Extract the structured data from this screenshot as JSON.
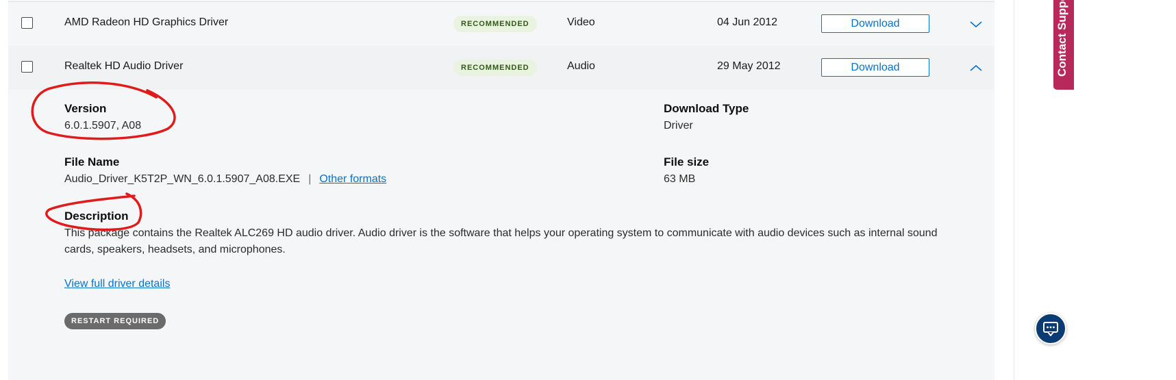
{
  "drivers": [
    {
      "name": "AMD Radeon HD Graphics Driver",
      "badge": "RECOMMENDED",
      "category": "Video",
      "date": "04 Jun 2012",
      "download_label": "Download",
      "expanded": false
    },
    {
      "name": "Realtek HD Audio Driver",
      "badge": "RECOMMENDED",
      "category": "Audio",
      "date": "29 May 2012",
      "download_label": "Download",
      "expanded": true
    }
  ],
  "details": {
    "version_label": "Version",
    "version_value": "6.0.1.5907, A08",
    "download_type_label": "Download Type",
    "download_type_value": "Driver",
    "file_name_label": "File Name",
    "file_name_value": "Audio_Driver_K5T2P_WN_6.0.1.5907_A08.EXE",
    "separator": "|",
    "other_formats": "Other formats",
    "file_size_label": "File size",
    "file_size_value": "63 MB",
    "description_label": "Description",
    "description_text": "This package contains the Realtek ALC269 HD audio driver. Audio driver is the software that helps your operating system to communicate with audio devices such as internal sound cards, speakers, headsets, and microphones.",
    "view_details": "View full driver details",
    "restart_badge": "RESTART REQUIRED"
  },
  "side": {
    "contact_label": "Contact Support"
  },
  "colors": {
    "link_blue": "#0672cb",
    "badge_green_bg": "#eaf3df",
    "badge_green_text": "#2f5a16",
    "restart_bg": "#6b6b6b",
    "contact_tab": "#b7295a",
    "chat_button": "#0b3b73",
    "annotation_red": "#e01b1b"
  },
  "icons": {
    "collapsed_row": "chevron-down-icon",
    "expanded_row": "chevron-up-icon",
    "chat": "chat-icon"
  }
}
